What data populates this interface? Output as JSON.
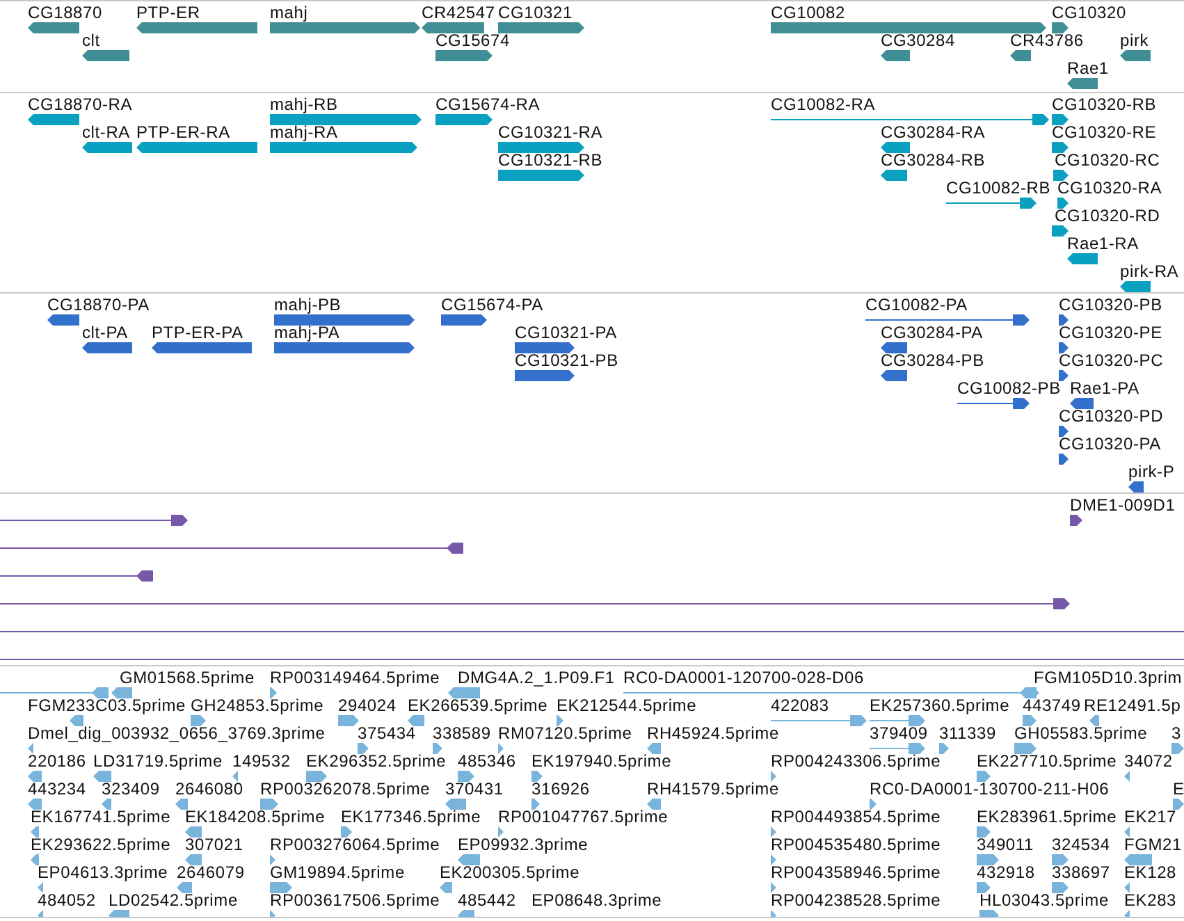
{
  "tracks": [
    {
      "color": "#408f96",
      "features": [
        {
          "label": "CG18870",
          "reverse": true,
          "kind": "block"
        },
        {
          "label": "PTP-ER",
          "reverse": true,
          "kind": "block"
        },
        {
          "label": "mahj",
          "reverse": false,
          "kind": "block"
        },
        {
          "label": "CR42547",
          "reverse": true,
          "kind": "block"
        },
        {
          "label": "CG10321",
          "reverse": false,
          "kind": "block"
        },
        {
          "label": "CG10082",
          "reverse": false,
          "kind": "block"
        },
        {
          "label": "CG10320",
          "reverse": false,
          "kind": "block"
        },
        {
          "label": "clt",
          "reverse": true,
          "kind": "block"
        },
        {
          "label": "CG15674",
          "reverse": false,
          "kind": "block"
        },
        {
          "label": "CG30284",
          "reverse": true,
          "kind": "block"
        },
        {
          "label": "CR43786",
          "reverse": true,
          "kind": "block"
        },
        {
          "label": "pirk",
          "reverse": true,
          "kind": "block"
        },
        {
          "label": "Rae1",
          "reverse": true,
          "kind": "block"
        }
      ]
    },
    {
      "color": "#0aa0c0",
      "features": [
        {
          "label": "CG18870-RA",
          "reverse": true,
          "kind": "block"
        },
        {
          "label": "mahj-RB",
          "reverse": false,
          "kind": "block"
        },
        {
          "label": "CG15674-RA",
          "reverse": false,
          "kind": "block"
        },
        {
          "label": "CG10082-RA",
          "reverse": false,
          "kind": "line"
        },
        {
          "label": "CG10320-RB",
          "reverse": false,
          "kind": "block"
        },
        {
          "label": "clt-RA",
          "reverse": true,
          "kind": "block"
        },
        {
          "label": "PTP-ER-RA",
          "reverse": true,
          "kind": "block"
        },
        {
          "label": "mahj-RA",
          "reverse": false,
          "kind": "block"
        },
        {
          "label": "CG10321-RA",
          "reverse": false,
          "kind": "block"
        },
        {
          "label": "CG30284-RA",
          "reverse": true,
          "kind": "block"
        },
        {
          "label": "CG10320-RE",
          "reverse": false,
          "kind": "block"
        },
        {
          "label": "CG10321-RB",
          "reverse": false,
          "kind": "block"
        },
        {
          "label": "CG30284-RB",
          "reverse": true,
          "kind": "block"
        },
        {
          "label": "CG10320-RC",
          "reverse": false,
          "kind": "block"
        },
        {
          "label": "CG10082-RB",
          "reverse": false,
          "kind": "line"
        },
        {
          "label": "CG10320-RA",
          "reverse": false,
          "kind": "block"
        },
        {
          "label": "CG10320-RD",
          "reverse": false,
          "kind": "block"
        },
        {
          "label": "Rae1-RA",
          "reverse": true,
          "kind": "block"
        },
        {
          "label": "pirk-RA",
          "reverse": true,
          "kind": "block"
        }
      ]
    },
    {
      "color": "#3370cc",
      "features": [
        {
          "label": "CG18870-PA",
          "reverse": true,
          "kind": "block"
        },
        {
          "label": "mahj-PB",
          "reverse": false,
          "kind": "block"
        },
        {
          "label": "CG15674-PA",
          "reverse": false,
          "kind": "block"
        },
        {
          "label": "CG10082-PA",
          "reverse": false,
          "kind": "line"
        },
        {
          "label": "CG10320-PB",
          "reverse": false,
          "kind": "block"
        },
        {
          "label": "clt-PA",
          "reverse": true,
          "kind": "block"
        },
        {
          "label": "PTP-ER-PA",
          "reverse": true,
          "kind": "block"
        },
        {
          "label": "mahj-PA",
          "reverse": false,
          "kind": "block"
        },
        {
          "label": "CG10321-PA",
          "reverse": false,
          "kind": "block"
        },
        {
          "label": "CG30284-PA",
          "reverse": true,
          "kind": "block"
        },
        {
          "label": "CG10320-PE",
          "reverse": false,
          "kind": "block"
        },
        {
          "label": "CG10321-PB",
          "reverse": false,
          "kind": "block"
        },
        {
          "label": "CG30284-PB",
          "reverse": true,
          "kind": "block"
        },
        {
          "label": "CG10320-PC",
          "reverse": false,
          "kind": "block"
        },
        {
          "label": "CG10082-PB",
          "reverse": false,
          "kind": "line"
        },
        {
          "label": "Rae1-PA",
          "reverse": true,
          "kind": "block"
        },
        {
          "label": "CG10320-PD",
          "reverse": false,
          "kind": "block"
        },
        {
          "label": "CG10320-PA",
          "reverse": false,
          "kind": "block"
        },
        {
          "label": "pirk-P",
          "reverse": true,
          "kind": "block"
        }
      ]
    },
    {
      "color": "#7658a8",
      "features": [
        {
          "label": "DME1-009D1",
          "reverse": false,
          "kind": "block"
        },
        {
          "reverse": false,
          "kind": "line"
        },
        {
          "reverse": true,
          "kind": "line"
        },
        {
          "reverse": true,
          "kind": "line"
        },
        {
          "reverse": false,
          "kind": "line"
        },
        {
          "kind": "plain"
        },
        {
          "kind": "plain"
        }
      ]
    },
    {
      "color": "#78b4dc",
      "features": [
        {
          "reverse": true,
          "kind": "line"
        },
        {
          "label": "GM01568.5prime",
          "reverse": true,
          "kind": "block"
        },
        {
          "label": "RP003149464.5prime",
          "reverse": false,
          "kind": "block"
        },
        {
          "label": "DMG4A.2_1.P09.F1",
          "reverse": true,
          "kind": "block"
        },
        {
          "label": "RC0-DA0001-120700-028-D06",
          "reverse": true,
          "kind": "line"
        },
        {
          "label": "FGM105D10.3prim",
          "reverse": false,
          "kind": "block"
        },
        {
          "label": "FGM233C03.5prime",
          "reverse": true,
          "kind": "block"
        },
        {
          "label": "GH24853.5prime",
          "reverse": false,
          "kind": "block"
        },
        {
          "label": "294024",
          "reverse": false,
          "kind": "block"
        },
        {
          "label": "EK266539.5prime",
          "reverse": true,
          "kind": "block"
        },
        {
          "label": "EK212544.5prime",
          "reverse": false,
          "kind": "block"
        },
        {
          "label": "422083",
          "reverse": false,
          "kind": "line"
        },
        {
          "label": "EK257360.5prime",
          "reverse": false,
          "kind": "line"
        },
        {
          "label": "443749",
          "reverse": false,
          "kind": "block"
        },
        {
          "label": "RE12491.5p",
          "reverse": true,
          "kind": "block"
        },
        {
          "label": "Dmel_dig_003932_0656_3769.3prime",
          "reverse": true,
          "kind": "block"
        },
        {
          "label": "375434",
          "reverse": false,
          "kind": "block"
        },
        {
          "label": "338589",
          "reverse": false,
          "kind": "block"
        },
        {
          "label": "RM07120.5prime",
          "reverse": false,
          "kind": "block"
        },
        {
          "label": "RH45924.5prime",
          "reverse": true,
          "kind": "block"
        },
        {
          "label": "379409",
          "reverse": false,
          "kind": "line"
        },
        {
          "label": "311339",
          "reverse": false,
          "kind": "block"
        },
        {
          "label": "GH05583.5prime",
          "reverse": false,
          "kind": "block"
        },
        {
          "label": "3",
          "reverse": false,
          "kind": "block"
        },
        {
          "label": "220186",
          "reverse": true,
          "kind": "block"
        },
        {
          "label": "LD31719.5prime",
          "reverse": true,
          "kind": "block"
        },
        {
          "label": "149532",
          "reverse": true,
          "kind": "block"
        },
        {
          "label": "EK296352.5prime",
          "reverse": false,
          "kind": "block"
        },
        {
          "label": "485346",
          "reverse": false,
          "kind": "block"
        },
        {
          "label": "EK197940.5prime",
          "reverse": false,
          "kind": "block"
        },
        {
          "label": "RP004243306.5prime",
          "reverse": false,
          "kind": "block"
        },
        {
          "label": "EK227710.5prime",
          "reverse": false,
          "kind": "block"
        },
        {
          "label": "34072",
          "reverse": true,
          "kind": "block"
        },
        {
          "label": "443234",
          "reverse": true,
          "kind": "block"
        },
        {
          "label": "323409",
          "reverse": true,
          "kind": "block"
        },
        {
          "label": "2646080",
          "reverse": true,
          "kind": "block"
        },
        {
          "label": "RP003262078.5prime",
          "reverse": false,
          "kind": "block"
        },
        {
          "label": "370431",
          "reverse": true,
          "kind": "block"
        },
        {
          "label": "316926",
          "reverse": false,
          "kind": "block"
        },
        {
          "label": "RH41579.5prime",
          "reverse": true,
          "kind": "block"
        },
        {
          "label": "RC0-DA0001-130700-211-H06",
          "reverse": false,
          "kind": "block"
        },
        {
          "label": "E",
          "reverse": false,
          "kind": "block"
        },
        {
          "label": "EK167741.5prime",
          "reverse": true,
          "kind": "block"
        },
        {
          "label": "EK184208.5prime",
          "reverse": true,
          "kind": "block"
        },
        {
          "label": "EK177346.5prime",
          "reverse": false,
          "kind": "block"
        },
        {
          "label": "RP001047767.5prime",
          "reverse": false,
          "kind": "block"
        },
        {
          "label": "RP004493854.5prime",
          "reverse": false,
          "kind": "block"
        },
        {
          "label": "EK283961.5prime",
          "reverse": false,
          "kind": "block"
        },
        {
          "label": "EK217",
          "reverse": true,
          "kind": "block"
        },
        {
          "label": "EK293622.5prime",
          "reverse": true,
          "kind": "block"
        },
        {
          "label": "307021",
          "reverse": true,
          "kind": "block"
        },
        {
          "label": "RP003276064.5prime",
          "reverse": false,
          "kind": "block"
        },
        {
          "label": "EP09932.3prime",
          "reverse": true,
          "kind": "block"
        },
        {
          "label": "RP004535480.5prime",
          "reverse": false,
          "kind": "block"
        },
        {
          "label": "349011",
          "reverse": false,
          "kind": "block"
        },
        {
          "label": "324534",
          "reverse": false,
          "kind": "block"
        },
        {
          "label": "FGM21",
          "reverse": true,
          "kind": "block"
        },
        {
          "label": "EP04613.3prime",
          "reverse": true,
          "kind": "block"
        },
        {
          "label": "2646079",
          "reverse": true,
          "kind": "block"
        },
        {
          "label": "GM19894.5prime",
          "reverse": false,
          "kind": "block"
        },
        {
          "label": "EK200305.5prime",
          "reverse": true,
          "kind": "block"
        },
        {
          "label": "RP004358946.5prime",
          "reverse": false,
          "kind": "block"
        },
        {
          "label": "432918",
          "reverse": false,
          "kind": "block"
        },
        {
          "label": "338697",
          "reverse": false,
          "kind": "block"
        },
        {
          "label": "EK128",
          "reverse": true,
          "kind": "block"
        },
        {
          "label": "484052",
          "reverse": true,
          "kind": "block"
        },
        {
          "label": "LD02542.5prime",
          "reverse": true,
          "kind": "block"
        },
        {
          "label": "RP003617506.5prime",
          "reverse": false,
          "kind": "block"
        },
        {
          "label": "485442",
          "reverse": true,
          "kind": "block"
        },
        {
          "label": "EP08648.3prime"
        },
        {
          "label": "RP004238528.5prime",
          "reverse": false,
          "kind": "block"
        },
        {
          "label": "HL03043.5prime",
          "reverse": false,
          "kind": "block"
        },
        {
          "label": "EK283",
          "reverse": true,
          "kind": "block"
        }
      ]
    }
  ]
}
